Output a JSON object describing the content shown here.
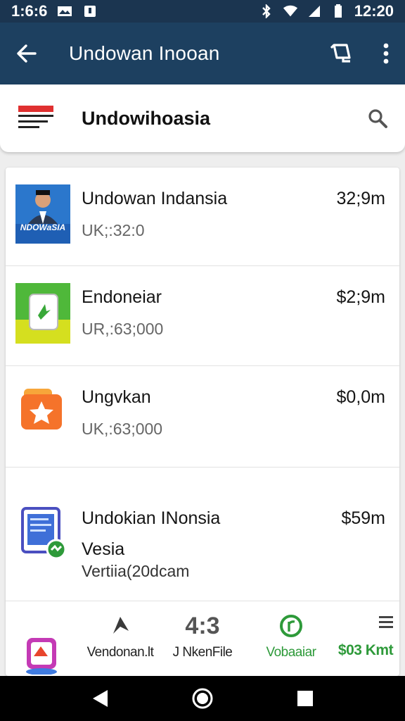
{
  "status_bar": {
    "time_left": "1:6:6",
    "time_right": "12:20"
  },
  "app_bar": {
    "title": "Undowan Inooan"
  },
  "search_bar": {
    "label": "Undowihoasia"
  },
  "items": [
    {
      "title": "Undowan Indansia",
      "subtitle": "UK;:32:0",
      "price": "32;9m",
      "logo_text": "NDOWaSIA"
    },
    {
      "title": "Endoneiar",
      "subtitle": "UR,:63;000",
      "price": "$2;9m"
    },
    {
      "title": "Ungvkan",
      "subtitle": "UK,:63;000",
      "price": "$0,0m"
    },
    {
      "title": "Undokian INonsia",
      "title2": "Vesia",
      "subtitle": "Vertiia(20dcam",
      "price": "$59m"
    }
  ],
  "bottom_nav": [
    {
      "label": "Vendonan.lt",
      "icon": "navigation-arrow-icon"
    },
    {
      "label": "J NkenFile",
      "icon_text": "4:3"
    },
    {
      "label": "Vobaaiar",
      "icon": "circle-r-icon",
      "active": true
    },
    {
      "label": "$03 Kmt",
      "icon": "menu-icon"
    }
  ],
  "colors": {
    "app_bar": "#1d4060",
    "status_bar": "#1b3550",
    "accent_green": "#2e9a3a"
  }
}
